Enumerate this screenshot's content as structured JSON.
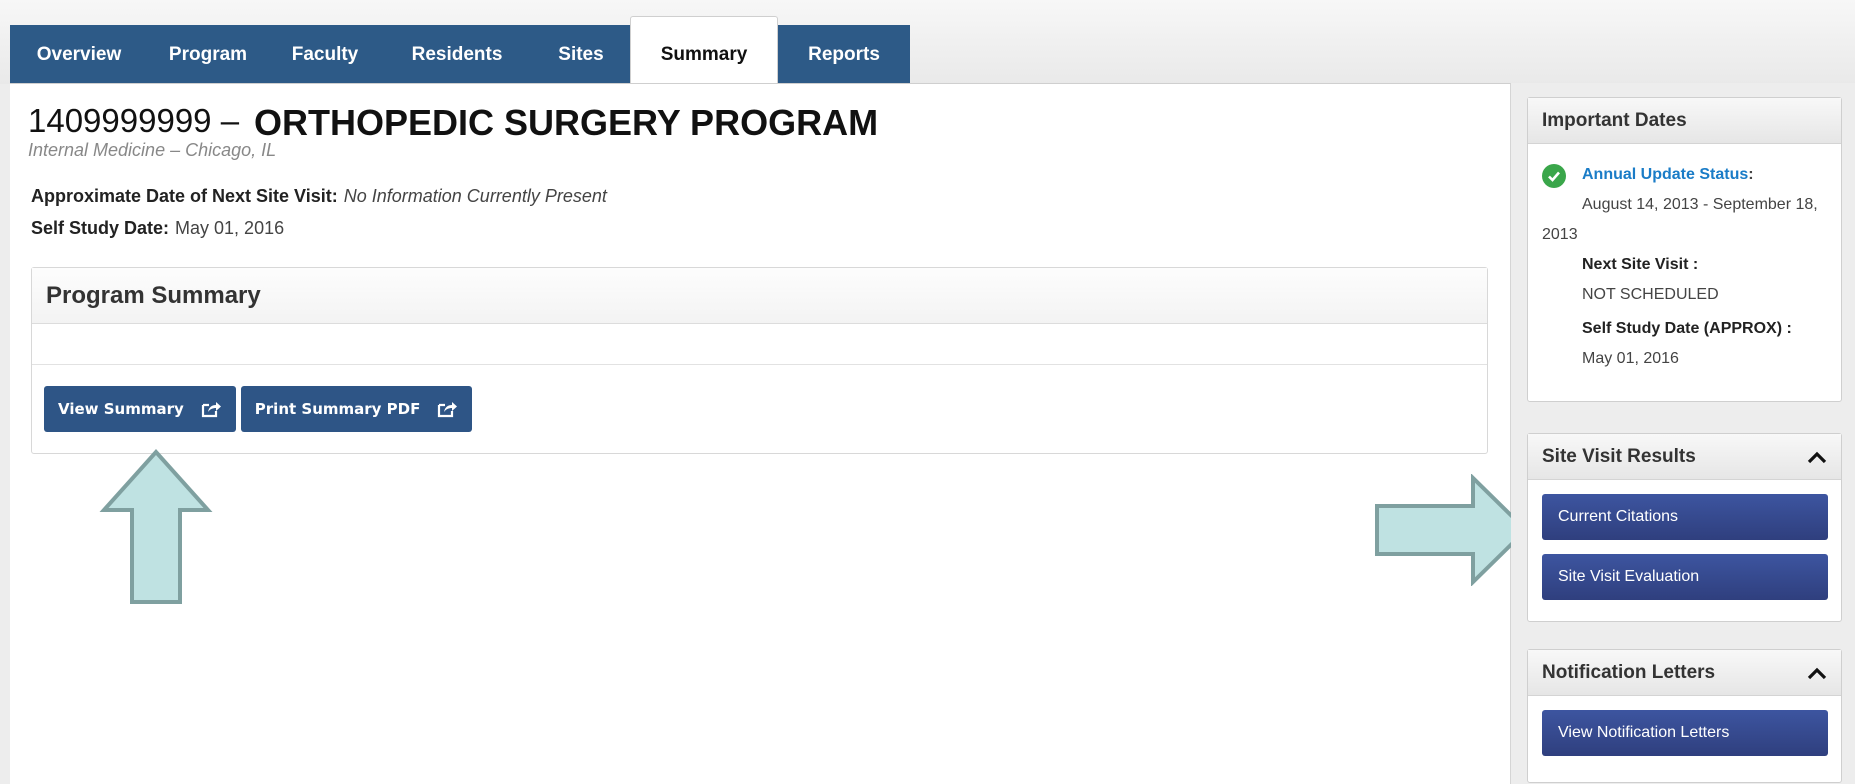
{
  "tabs": [
    {
      "label": "Overview",
      "active": false
    },
    {
      "label": "Program",
      "active": false
    },
    {
      "label": "Faculty",
      "active": false
    },
    {
      "label": "Residents",
      "active": false
    },
    {
      "label": "Sites",
      "active": false
    },
    {
      "label": "Summary",
      "active": true
    },
    {
      "label": "Reports",
      "active": false
    }
  ],
  "program": {
    "id_prefix": "1409999999 –",
    "name": "ORTHOPEDIC SURGERY PROGRAM",
    "subtitle": "Internal Medicine – Chicago, IL",
    "next_site_visit_label": "Approximate Date of Next Site Visit:",
    "next_site_visit_value": "No Information Currently Present",
    "self_study_label": "Self Study Date:",
    "self_study_value": "May 01, 2016"
  },
  "summary_panel": {
    "title": "Program Summary",
    "view_button": "View Summary",
    "print_button": "Print Summary PDF"
  },
  "important_dates": {
    "title": "Important Dates",
    "annual_update_label": "Annual Update Status",
    "annual_update_colon": ":",
    "annual_update_value": "August 14, 2013 - September 18, 2013",
    "next_site_visit_label": "Next Site Visit :",
    "next_site_visit_value": "NOT SCHEDULED",
    "self_study_label": "Self Study Date (APPROX) :",
    "self_study_value": "May 01, 2016"
  },
  "site_visit_results": {
    "title": "Site Visit Results",
    "buttons": [
      "Current Citations",
      "Site Visit Evaluation"
    ]
  },
  "notification_letters": {
    "title": "Notification Letters",
    "buttons": [
      "View Notification Letters"
    ]
  },
  "icons": {
    "external_link": "external-link-icon",
    "collapse": "chevron-up-icon",
    "status_ok": "check-circle-icon",
    "callout_arrow": "arrow-icon"
  },
  "colors": {
    "tab_bg": "#2d5a87",
    "button_bg": "#2e5586",
    "side_button_bg": "#35478a",
    "status_ok": "#3aa64a",
    "link": "#1a7cc7",
    "arrow_fill": "#bfe2e2",
    "arrow_stroke": "#7fa0a0"
  }
}
